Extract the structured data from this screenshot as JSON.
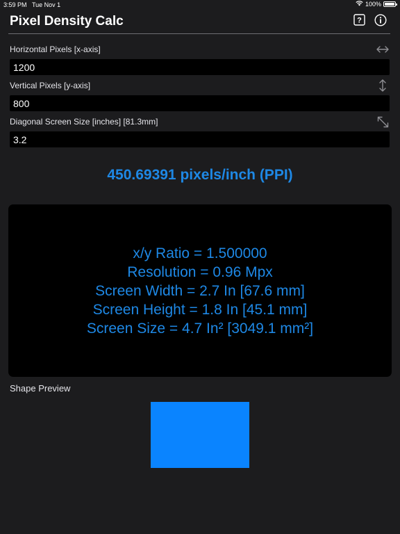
{
  "status_bar": {
    "time": "3:59 PM",
    "date": "Tue Nov 1",
    "battery": "100%",
    "wifi_icon": "wifi-icon",
    "battery_icon": "battery-icon"
  },
  "nav": {
    "title": "Pixel Density Calc",
    "help_icon": "question-mark-square-icon",
    "info_icon": "info-circle-icon"
  },
  "fields": {
    "horizontal": {
      "label": "Horizontal Pixels  [x-axis]",
      "value": "1200",
      "icon": "horizontal-arrows-icon"
    },
    "vertical": {
      "label": "Vertical Pixels [y-axis]",
      "value": "800",
      "icon": "vertical-arrows-icon"
    },
    "diagonal": {
      "label": "Diagonal Screen Size [inches] [81.3mm]",
      "value": "3.2",
      "icon": "diagonal-arrows-icon"
    }
  },
  "result": {
    "ppi": "450.69391 pixels/inch (PPI)"
  },
  "details": {
    "ratio": "x/y Ratio = 1.500000",
    "resolution": "Resolution = 0.96 Mpx",
    "width": "Screen Width = 2.7 In [67.6 mm]",
    "height": "Screen Height = 1.8 In [45.1 mm]",
    "size": "Screen Size = 4.7 In² [3049.1 mm²]"
  },
  "preview": {
    "label": "Shape Preview",
    "aspect_ratio": 1.5,
    "fill_color": "#0a84ff"
  },
  "colors": {
    "accent": "#1e88e5",
    "background": "#1c1c1e",
    "panel": "#000000"
  }
}
